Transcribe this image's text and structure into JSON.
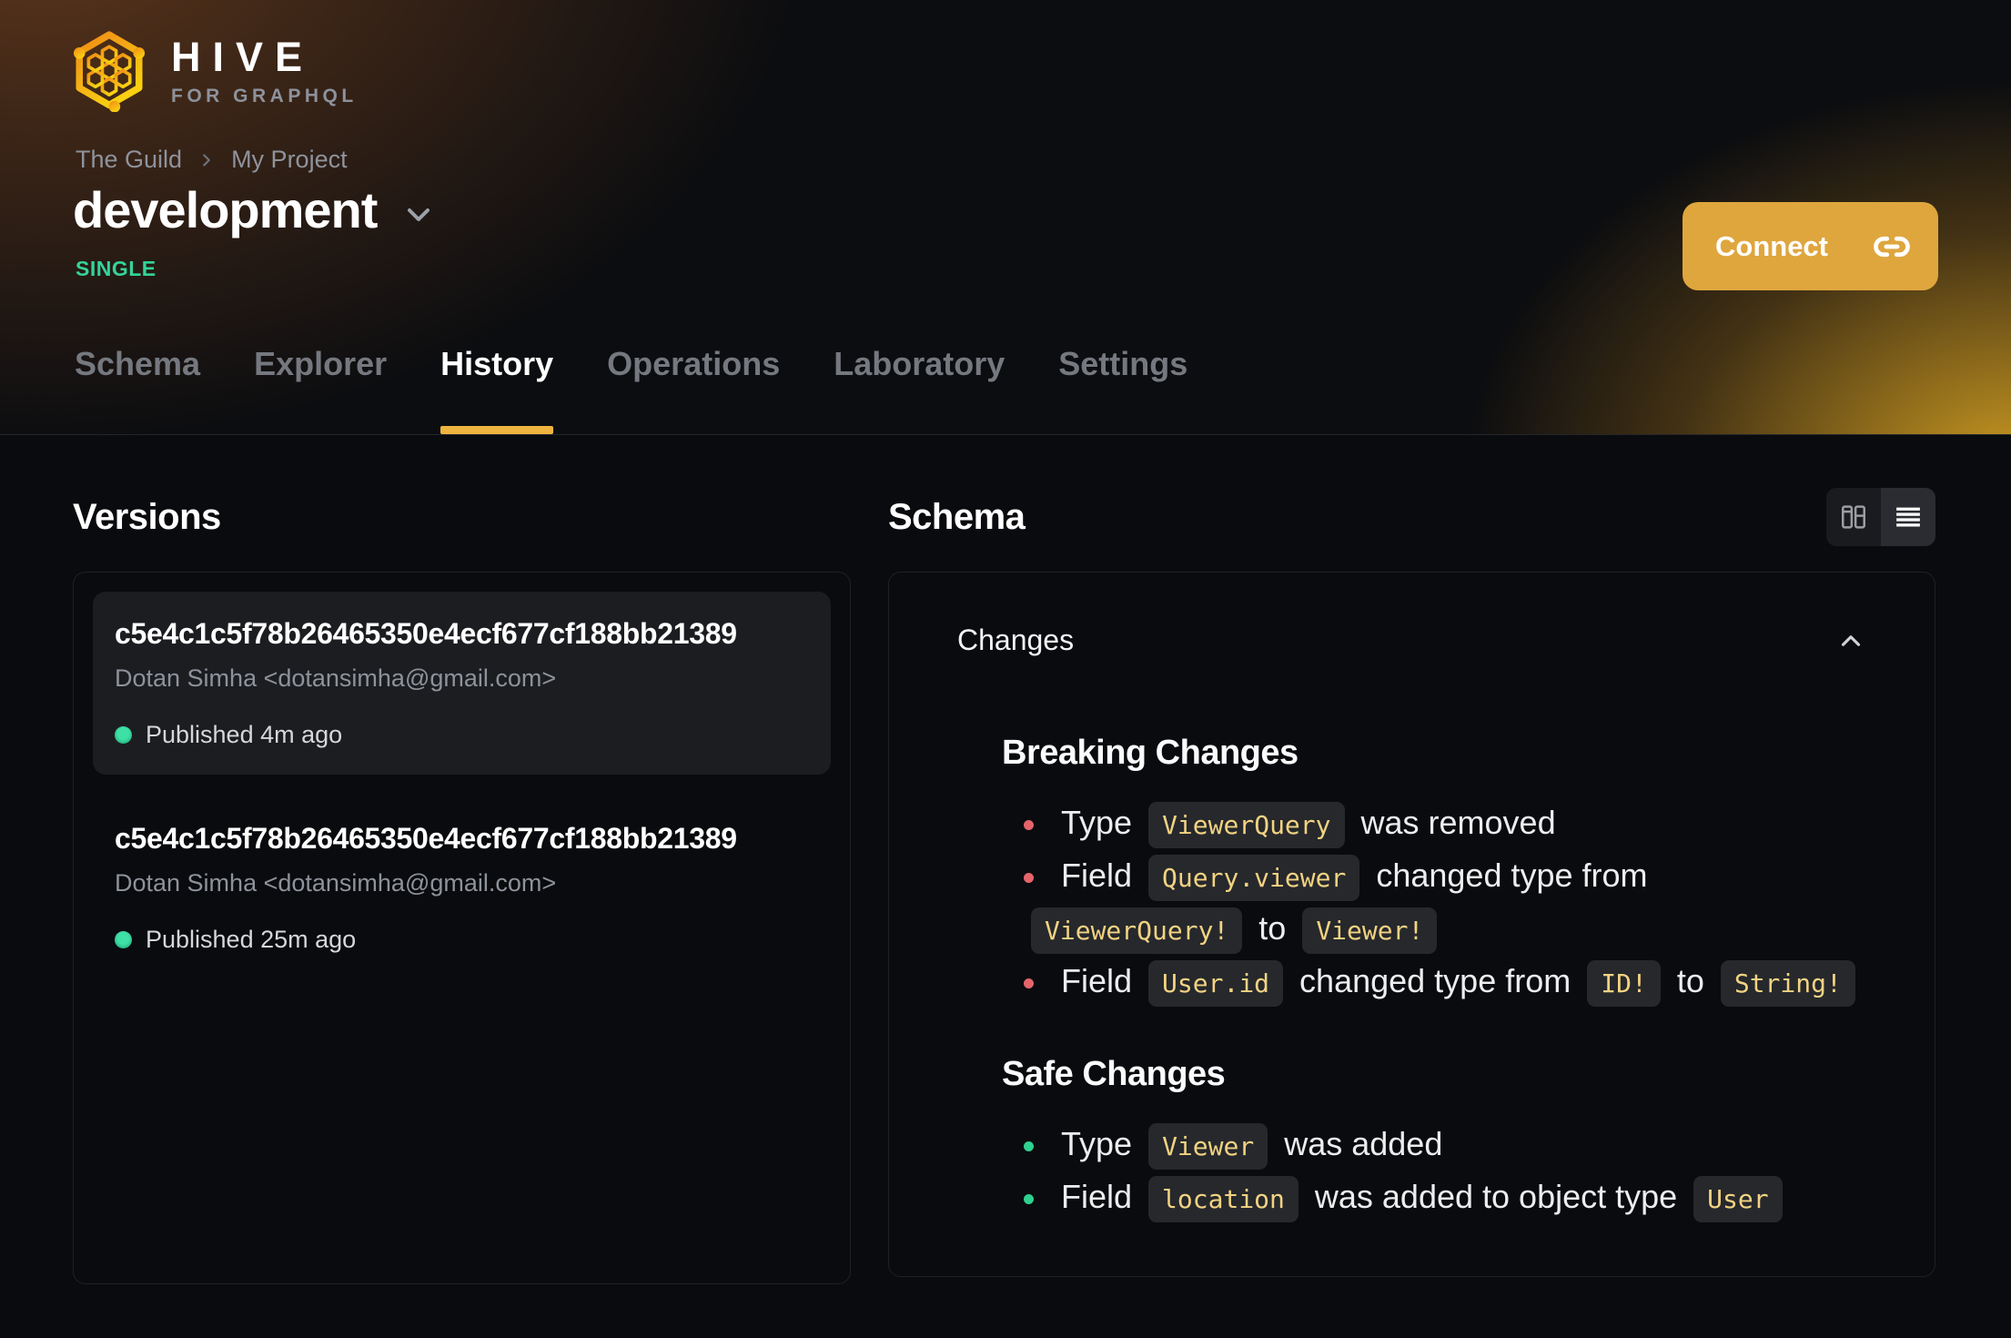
{
  "brand": {
    "name": "HIVE",
    "tagline": "FOR GRAPHQL"
  },
  "breadcrumb": {
    "items": [
      "The Guild",
      "My Project"
    ]
  },
  "target": {
    "title": "development",
    "badge": "SINGLE"
  },
  "connect": {
    "label": "Connect"
  },
  "tabs": {
    "items": [
      {
        "label": "Schema",
        "active": false
      },
      {
        "label": "Explorer",
        "active": false
      },
      {
        "label": "History",
        "active": true
      },
      {
        "label": "Operations",
        "active": false
      },
      {
        "label": "Laboratory",
        "active": false
      },
      {
        "label": "Settings",
        "active": false
      }
    ]
  },
  "versions": {
    "heading": "Versions",
    "items": [
      {
        "hash": "c5e4c1c5f78b26465350e4ecf677cf188bb21389",
        "author": "Dotan Simha <dotansimha@gmail.com>",
        "status": "Published 4m ago",
        "active": true
      },
      {
        "hash": "c5e4c1c5f78b26465350e4ecf677cf188bb21389",
        "author": "Dotan Simha <dotansimha@gmail.com>",
        "status": "Published 25m ago",
        "active": false
      }
    ]
  },
  "schema": {
    "heading": "Schema",
    "view_toggle": {
      "options": [
        "columns-view",
        "list-view"
      ],
      "selected": "list-view"
    },
    "changes": {
      "title": "Changes",
      "collapsed": false,
      "sections": [
        {
          "heading": "Breaking Changes",
          "kind": "breaking",
          "items": [
            [
              {
                "t": "text",
                "v": "Type "
              },
              {
                "t": "code",
                "v": "ViewerQuery"
              },
              {
                "t": "text",
                "v": " was removed"
              }
            ],
            [
              {
                "t": "text",
                "v": "Field "
              },
              {
                "t": "code",
                "v": "Query.viewer"
              },
              {
                "t": "text",
                "v": " changed type from "
              },
              {
                "t": "code",
                "v": "ViewerQuery!"
              },
              {
                "t": "text",
                "v": " to "
              },
              {
                "t": "code",
                "v": "Viewer!"
              }
            ],
            [
              {
                "t": "text",
                "v": "Field "
              },
              {
                "t": "code",
                "v": "User.id"
              },
              {
                "t": "text",
                "v": " changed type from "
              },
              {
                "t": "code",
                "v": "ID!"
              },
              {
                "t": "text",
                "v": " to "
              },
              {
                "t": "code",
                "v": "String!"
              }
            ]
          ]
        },
        {
          "heading": "Safe Changes",
          "kind": "safe",
          "items": [
            [
              {
                "t": "text",
                "v": "Type "
              },
              {
                "t": "code",
                "v": "Viewer"
              },
              {
                "t": "text",
                "v": " was added"
              }
            ],
            [
              {
                "t": "text",
                "v": "Field "
              },
              {
                "t": "code",
                "v": "location"
              },
              {
                "t": "text",
                "v": " was added to object type "
              },
              {
                "t": "code",
                "v": "User"
              }
            ]
          ]
        }
      ]
    }
  },
  "colors": {
    "accent": "#efb440",
    "connect_button": "#dfa63e",
    "badge_green": "#34d399",
    "breaking_bullet": "#e5646c",
    "safe_bullet": "#30d090",
    "code_text": "#f2d382"
  }
}
